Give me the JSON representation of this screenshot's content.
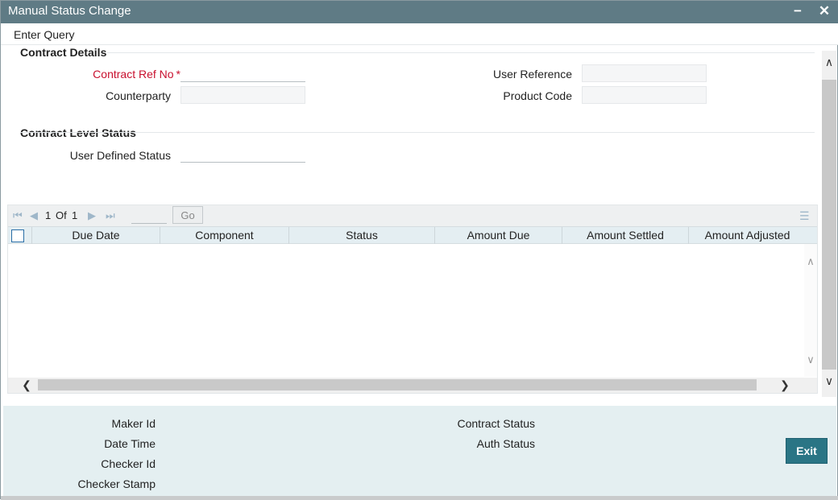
{
  "window": {
    "title": "Manual Status Change",
    "minimize_glyph": "−",
    "close_glyph": "✕"
  },
  "menu": {
    "enter_query": "Enter Query"
  },
  "contract_details": {
    "title": "Contract Details",
    "contract_ref_no": {
      "label": "Contract Ref No",
      "required_mark": "*",
      "value": ""
    },
    "counterparty": {
      "label": "Counterparty",
      "value": ""
    },
    "user_reference": {
      "label": "User Reference",
      "value": ""
    },
    "product_code": {
      "label": "Product Code",
      "value": ""
    }
  },
  "contract_level_status": {
    "title": "Contract Level Status",
    "user_defined_status": {
      "label": "User Defined Status",
      "value": ""
    }
  },
  "grid": {
    "pager": {
      "current": "1",
      "of_label": "Of",
      "total": "1",
      "go_label": "Go"
    },
    "columns": [
      "Due Date",
      "Component",
      "Status",
      "Amount Due",
      "Amount Settled",
      "Amount Adjusted"
    ],
    "rows": []
  },
  "footer": {
    "maker_id": "Maker Id",
    "date_time": "Date Time",
    "checker_id": "Checker Id",
    "checker_stamp": "Checker Stamp",
    "contract_status": "Contract Status",
    "auth_status": "Auth Status",
    "exit_label": "Exit"
  },
  "colors": {
    "titlebar": "#5f7b85",
    "required": "#c8102e",
    "exit_button": "#2a7585",
    "footer_bg": "#e4eff1",
    "grid_header": "#e4eef2"
  }
}
